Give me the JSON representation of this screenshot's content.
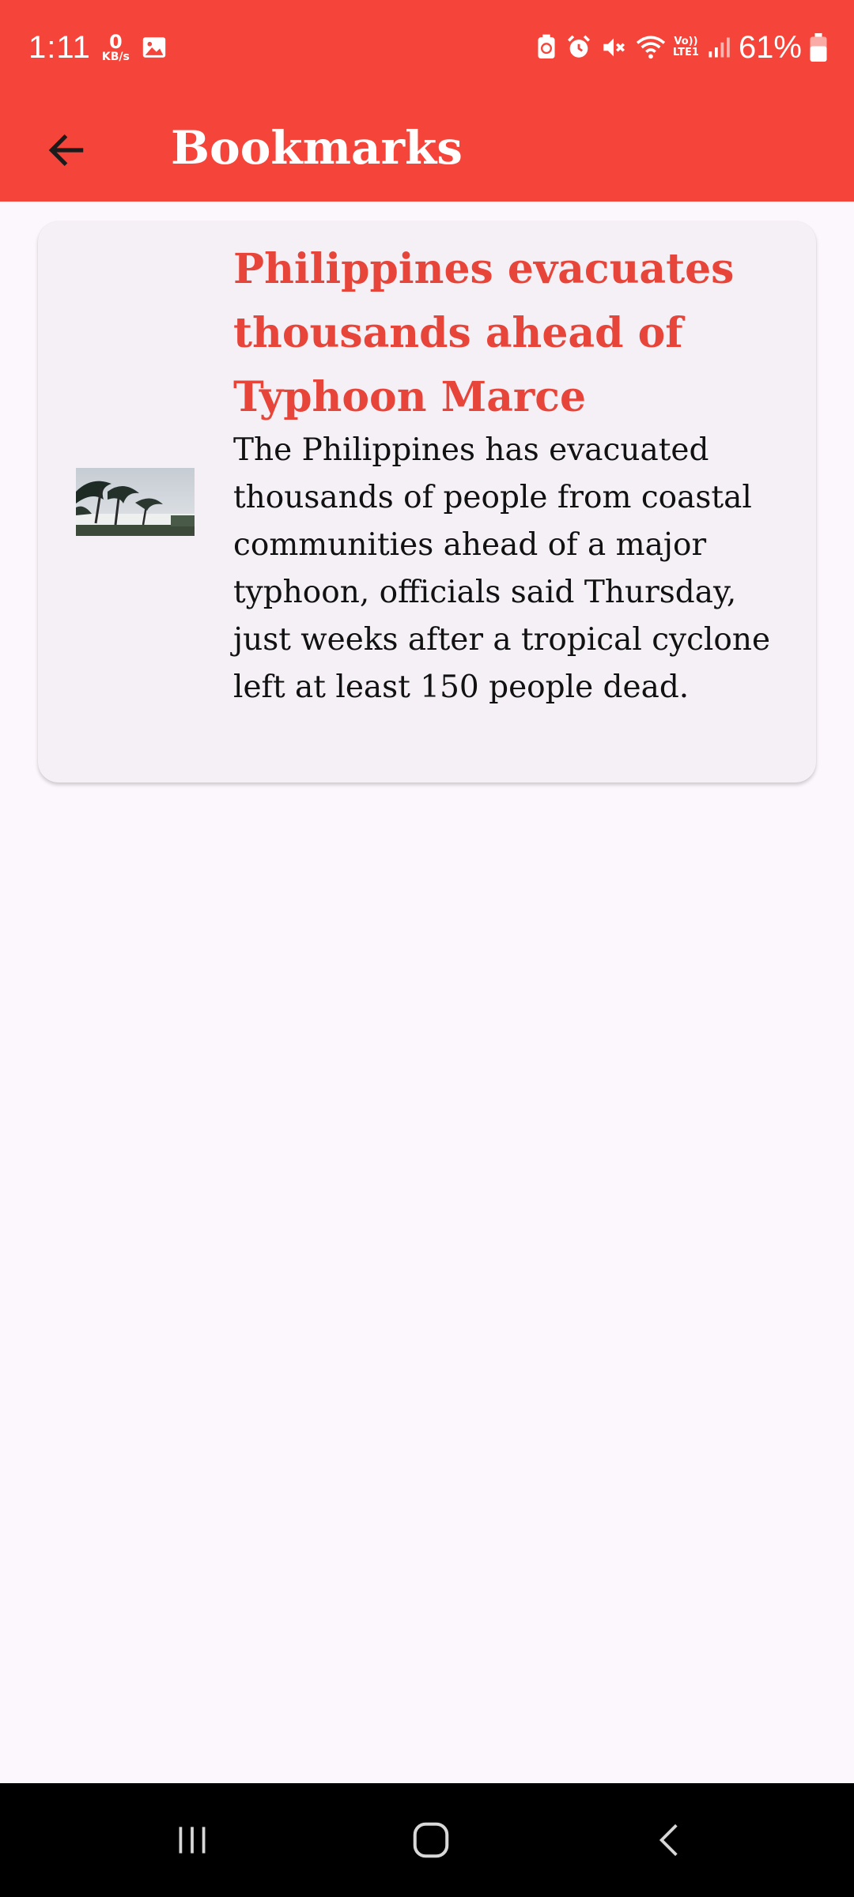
{
  "status_bar": {
    "time": "1:11",
    "net_speed_value": "0",
    "net_speed_unit": "KB/s",
    "volte_top": "Vo))",
    "volte_bottom": "LTE1",
    "battery": "61%"
  },
  "app_bar": {
    "title": "Bookmarks"
  },
  "bookmarks": [
    {
      "headline": "Philippines evacuates thousands ahead of Typhoon Marce",
      "summary": "The Philippines has evacuated thousands of people from coastal communities ahead of a major typhoon, officials said Thursday, just weeks after a tropical cyclone left at least 150 people dead."
    }
  ],
  "colors": {
    "accent": "#f5453a",
    "headline": "#e8453a",
    "background": "#fcf7fc",
    "card": "#f4f0f6"
  },
  "icons": {
    "back": "arrow-left-icon",
    "gallery": "image-icon",
    "nav_recents": "recents-icon",
    "nav_home": "home-icon",
    "nav_back": "chevron-left-icon"
  }
}
